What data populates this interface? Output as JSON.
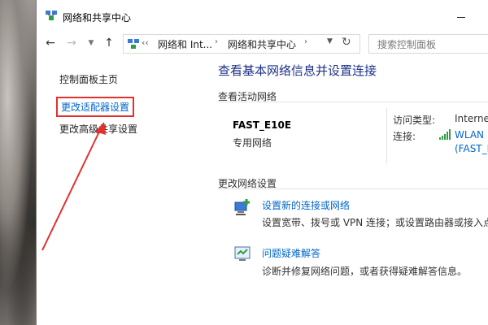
{
  "window": {
    "title": "网络和共享中心"
  },
  "address_bar": {
    "chevrons": "‹‹",
    "crumb1": "网络和 Int...",
    "crumb2": "网络和共享中心"
  },
  "search": {
    "placeholder": "搜索控制面板"
  },
  "left_pane": {
    "home": "控制面板主页",
    "adapter_settings": "更改适配器设置",
    "advanced_sharing": "更改高级共享设置"
  },
  "main": {
    "title": "查看基本网络信息并设置连接",
    "active_network_heading": "查看活动网络",
    "network_name": "FAST_E10E",
    "network_type": "专用网络",
    "access_type_label": "访问类型:",
    "access_type_value": "Internet",
    "connections_label": "连接:",
    "connection_value": "WLAN",
    "connection_value_2": "(FAST_E",
    "change_settings_heading": "更改网络设置",
    "task_new_link": "设置新的连接或网络",
    "task_new_desc": "设置宽带、拨号或 VPN 连接；或设置路由器或接入点",
    "task_trouble_link": "问题疑难解答",
    "task_trouble_desc": "诊断并修复网络问题，或者获得疑难解答信息。"
  },
  "colors": {
    "link": "#0066cc",
    "title_blue": "#1e3287",
    "highlight_red": "#e0322e"
  },
  "icons": [
    "network-center-icon",
    "back-arrow-icon",
    "forward-arrow-icon",
    "recent-dropdown-icon",
    "up-arrow-icon",
    "refresh-icon",
    "wifi-signal-icon",
    "new-connection-icon",
    "troubleshoot-icon",
    "minimize-icon"
  ]
}
